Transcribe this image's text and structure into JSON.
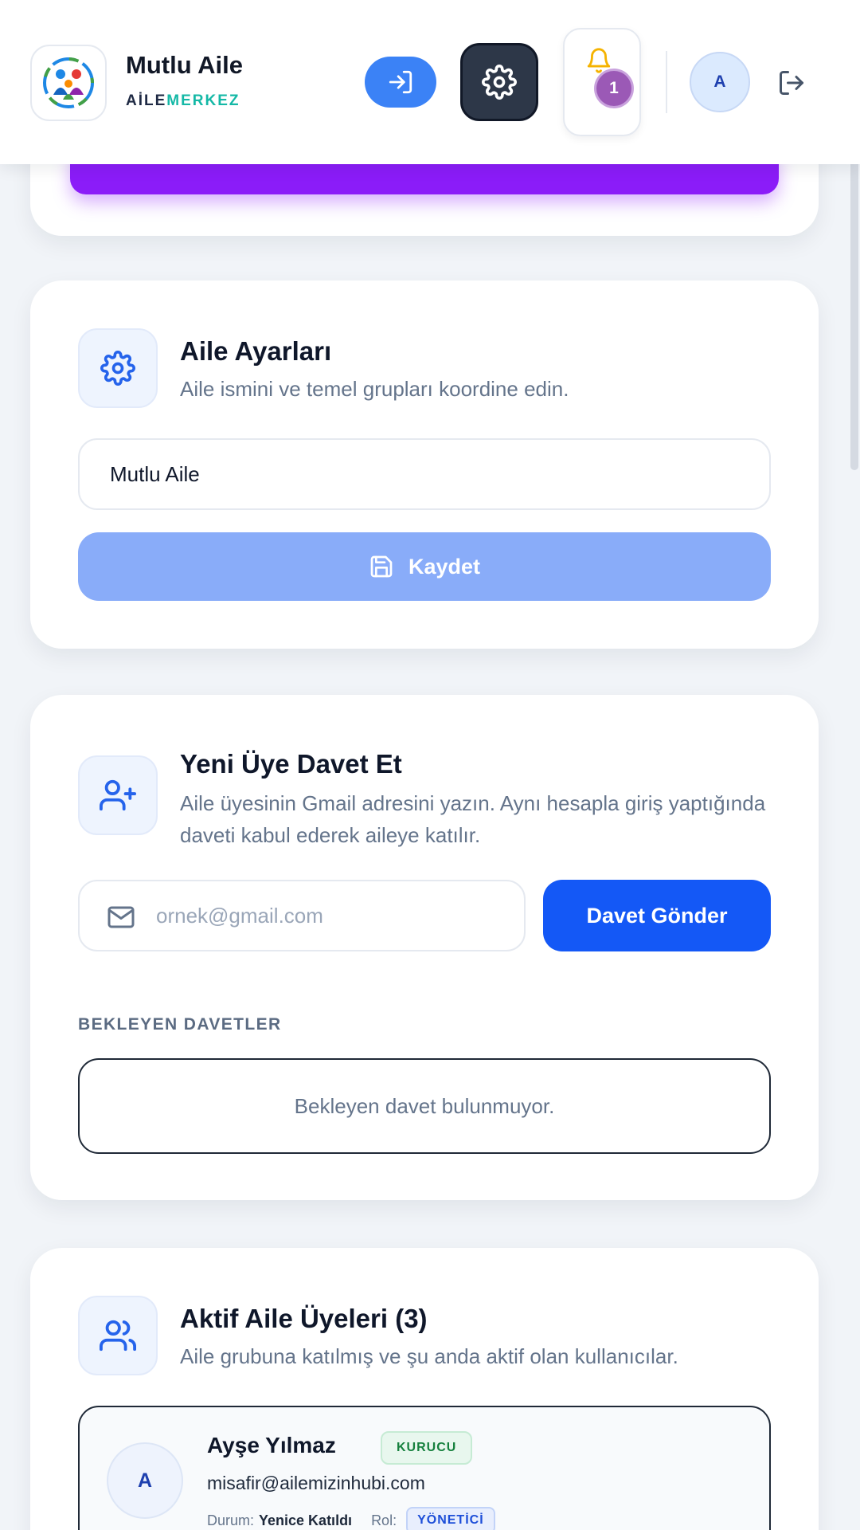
{
  "header": {
    "brand_name": "Mutlu Aile",
    "brand_sub_part1": "AİLE",
    "brand_sub_part2": "MERKEZ",
    "notification_count": "1",
    "avatar_initial": "A"
  },
  "settings_card": {
    "title": "Aile Ayarları",
    "description": "Aile ismini ve temel grupları koordine edin.",
    "family_name_value": "Mutlu Aile",
    "save_label": "Kaydet"
  },
  "invite_card": {
    "title": "Yeni Üye Davet Et",
    "description": "Aile üyesinin Gmail adresini yazın. Aynı hesapla giriş yaptığında daveti kabul ederek aileye katılır.",
    "email_placeholder": "ornek@gmail.com",
    "send_label": "Davet Gönder",
    "pending_heading": "BEKLEYEN DAVETLER",
    "pending_empty": "Bekleyen davet bulunmuyor."
  },
  "members_card": {
    "title": "Aktif Aile Üyeleri (3)",
    "description": "Aile grubuna katılmış ve şu anda aktif olan kullanıcılar.",
    "members": [
      {
        "initial": "A",
        "name": "Ayşe Yılmaz",
        "badge": "KURUCU",
        "email": "misafir@ailemizinhubi.com",
        "status_label": "Durum:",
        "status_value": "Yenice Katıldı",
        "role_label": "Rol:",
        "role_value": "YÖNETİCİ"
      }
    ]
  },
  "colors": {
    "primary": "#1458f6",
    "accent_purple": "#8b1cf8",
    "brand_teal": "#14b8a6",
    "dark_button": "#2d3748"
  }
}
